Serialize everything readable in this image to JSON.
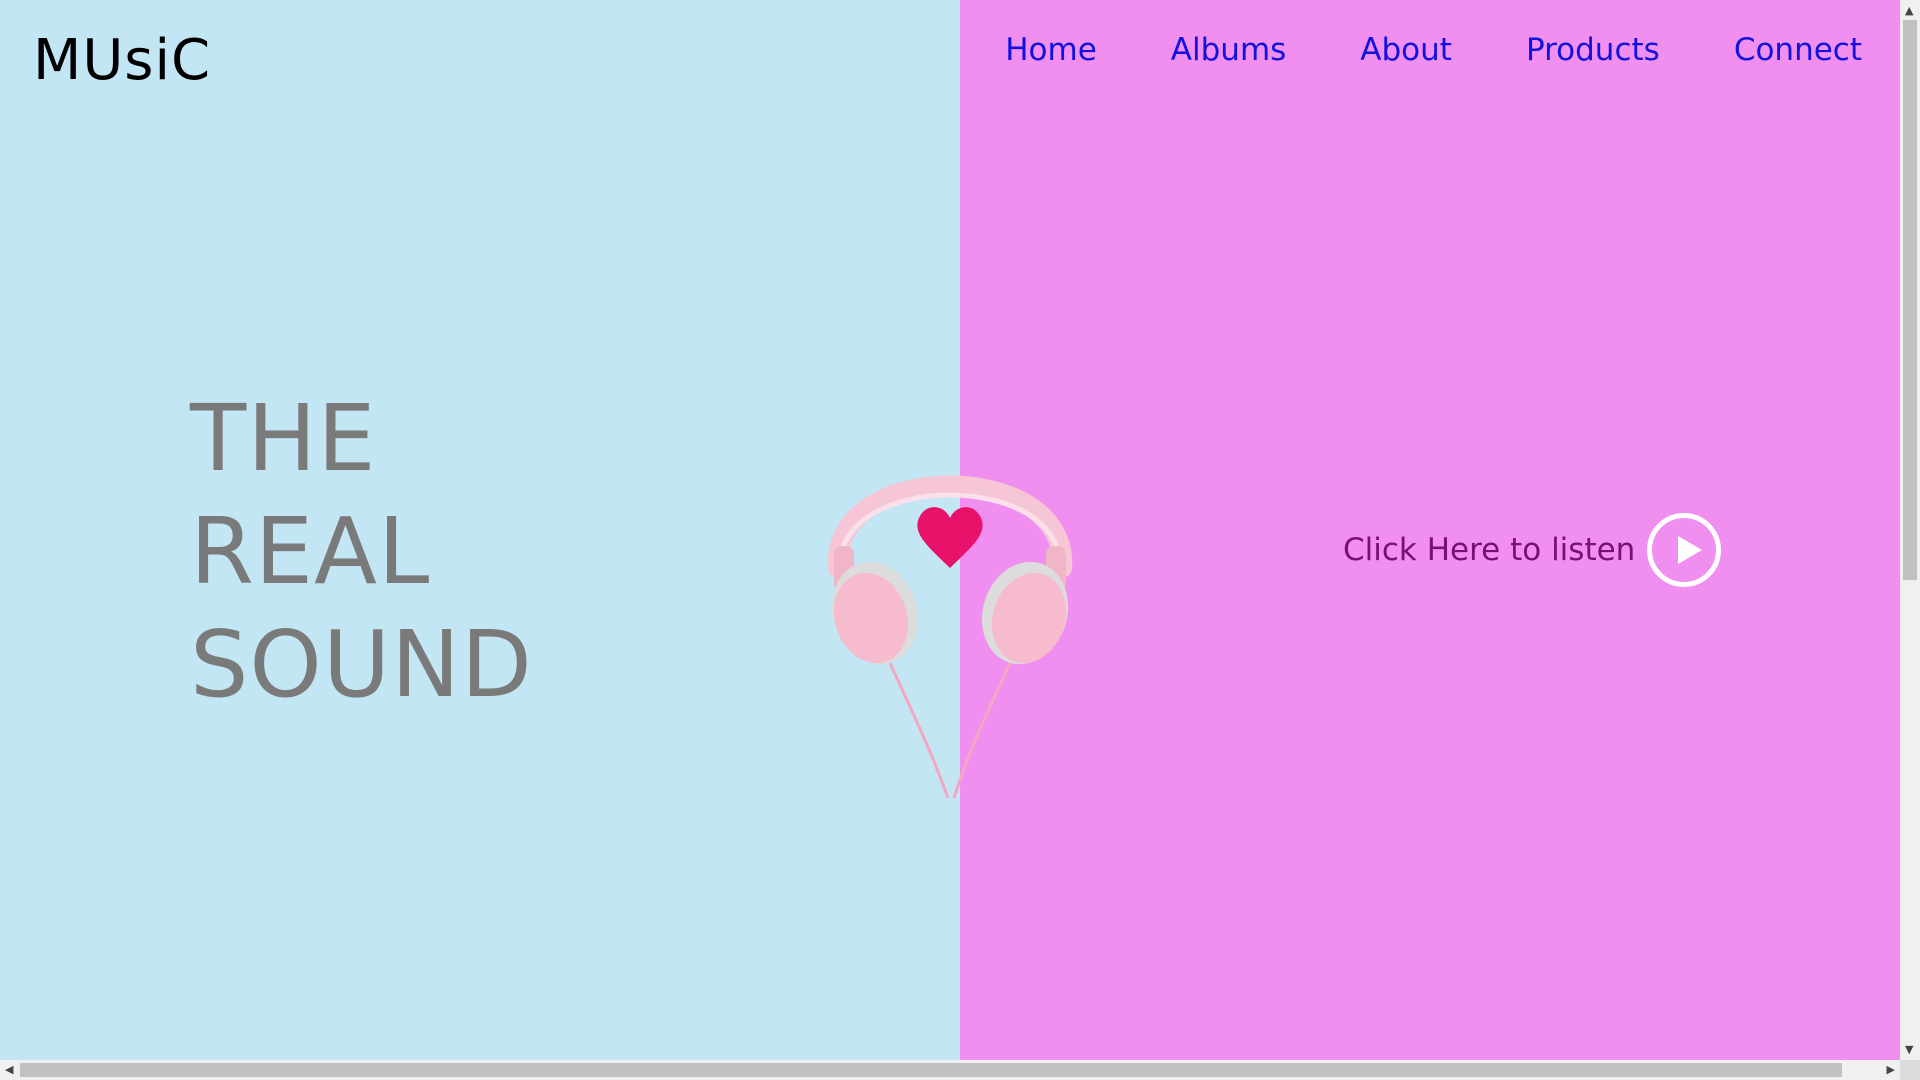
{
  "brand": {
    "logo": "MUsiC"
  },
  "nav": {
    "items": [
      "Home",
      "Albums",
      "About",
      "Products",
      "Connect"
    ]
  },
  "hero": {
    "lines": [
      "THE",
      "REAL",
      "SOUND"
    ]
  },
  "cta": {
    "label": "Click Here to listen",
    "icon": "play-circle-icon"
  },
  "image": {
    "name": "pink-headphones-with-heart"
  },
  "colors": {
    "left_bg": "#c2e6f4",
    "right_bg": "#f08ff0",
    "nav_text": "#1212dc",
    "hero_text": "#7a7a7a",
    "cta_text": "#7a0e7a",
    "heart": "#e8126a"
  }
}
